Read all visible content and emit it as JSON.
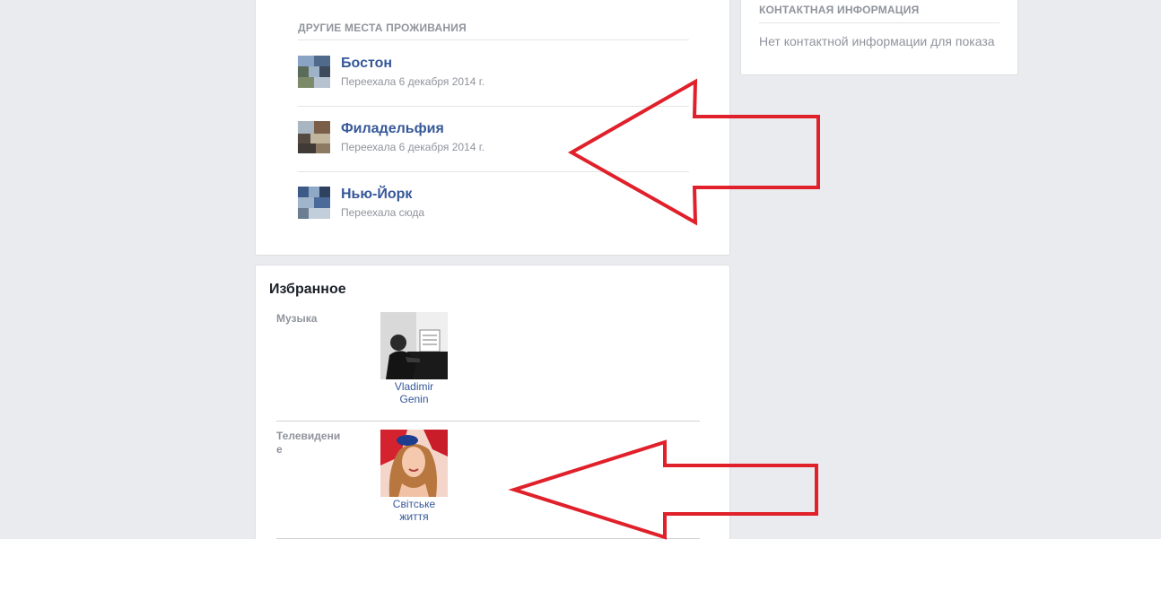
{
  "places": {
    "heading": "ДРУГИЕ МЕСТА ПРОЖИВАНИЯ",
    "items": [
      {
        "name": "Бостон",
        "subtitle": "Переехала 6 декабря 2014 г."
      },
      {
        "name": "Филадельфия",
        "subtitle": "Переехала 6 декабря 2014 г."
      },
      {
        "name": "Нью-Йорк",
        "subtitle": "Переехала сюда"
      }
    ]
  },
  "contact": {
    "heading": "КОНТАКТНАЯ ИНФОРМАЦИЯ",
    "empty_text": "Нет контактной информации для показа"
  },
  "favorites": {
    "title": "Избранное",
    "categories": [
      {
        "label": "Музыка",
        "item_name": "Vladimir Genin"
      },
      {
        "label": "Телевидение",
        "item_name": "Світське життя"
      }
    ]
  },
  "colors": {
    "link": "#365899",
    "muted": "#90949c",
    "background": "#e9ebee",
    "annotation_arrow": "#e0202a"
  }
}
